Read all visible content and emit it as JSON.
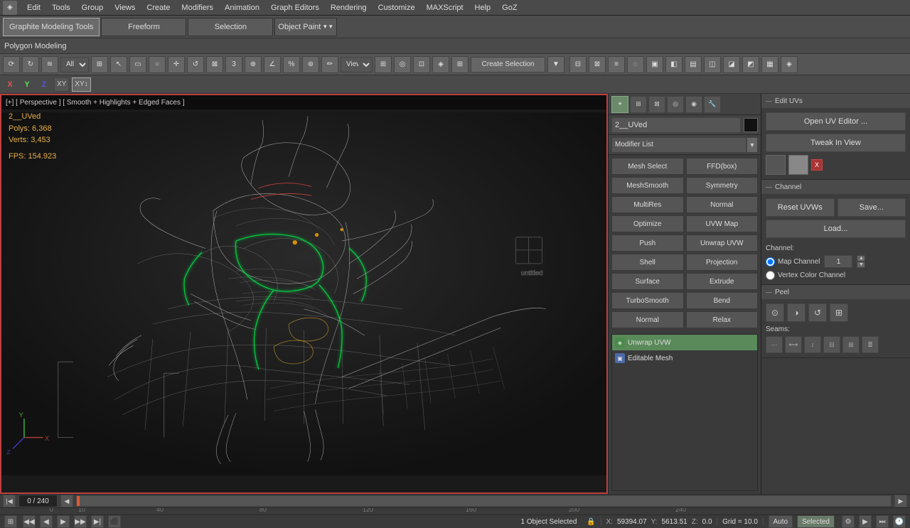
{
  "app": {
    "title": "3ds Max",
    "icon": "◈"
  },
  "menu": {
    "items": [
      "Edit",
      "Tools",
      "Group",
      "Views",
      "Create",
      "Modifiers",
      "Animation",
      "Graph Editors",
      "Rendering",
      "Customize",
      "MAXScript",
      "Help",
      "GoZ"
    ]
  },
  "toolbar1": {
    "graphite_label": "Graphite Modeling Tools",
    "freeform_label": "Freeform",
    "selection_label": "Selection",
    "object_paint_label": "Object Paint",
    "polygon_modeling_label": "Polygon Modeling"
  },
  "toolbar2": {
    "all_label": "All",
    "view_label": "View",
    "create_selection_label": "Create Selection",
    "num_label": "3"
  },
  "axis": {
    "x": "X",
    "y": "Y",
    "z": "Z",
    "xy": "XY",
    "xym": "XY↕"
  },
  "viewport": {
    "header": "[+] [ Perspective ] [ Smooth + Highlights + Edged Faces ]",
    "obj_name": "2__UVed",
    "polys_label": "Polys:",
    "polys_value": "6,368",
    "verts_label": "Verts:",
    "verts_value": "3,453",
    "fps_label": "FPS:",
    "fps_value": "154.923",
    "cube_label": "untitled"
  },
  "right_panel": {
    "obj_name": "2__UVed",
    "modifier_list_label": "Modifier List",
    "buttons": [
      "Mesh Select",
      "FFD(box)",
      "MeshSmooth",
      "Symmetry",
      "MultiRes",
      "Normal",
      "Optimize",
      "UVW Map",
      "Push",
      "Unwrap UVW",
      "Shell",
      "Projection",
      "Surface",
      "Extrude",
      "TurboSmooth",
      "Bend",
      "Normal",
      "Relax"
    ],
    "stack": [
      {
        "name": "Unwrap UVW",
        "type": "active"
      },
      {
        "name": "Editable Mesh",
        "type": "normal"
      }
    ]
  },
  "edit_uvs": {
    "section_title": "Edit UVs",
    "open_uv_editor_label": "Open UV Editor ...",
    "tweak_in_view_label": "Tweak In View",
    "channel_title": "Channel",
    "reset_uvws_label": "Reset UVWs",
    "save_label": "Save...",
    "load_label": "Load...",
    "channel_label": "Channel:",
    "map_channel_label": "Map Channel",
    "map_channel_value": "1",
    "vertex_color_label": "Vertex Color Channel",
    "peel_title": "Peel",
    "seams_label": "Seams:"
  },
  "timeline": {
    "counter": "0 / 240",
    "frames": [
      "0",
      "10",
      "40",
      "80",
      "120",
      "160",
      "200",
      "240"
    ]
  },
  "status_bar": {
    "message": "1 Object Selected",
    "lock_icon": "🔒",
    "x_label": "X:",
    "x_value": "59394.07",
    "y_label": "Y:",
    "y_value": "5613.51",
    "z_label": "Z:",
    "z_value": "0.0",
    "grid_label": "Grid = 10.0",
    "auto_label": "Auto",
    "selected_label": "Selected"
  }
}
